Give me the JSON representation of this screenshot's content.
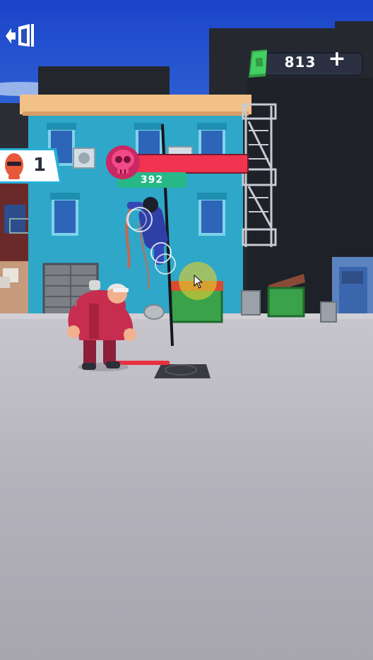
{
  "hud": {
    "cash_value": "813",
    "cash_plus": "+",
    "enemies_remaining": "1",
    "boss_hp_value": "392"
  },
  "colors": {
    "sky_top": "#1d4fd6",
    "sky_bottom": "#7fb0ef",
    "building_blue": "#2ea7c9",
    "ground": "#b7b5c0",
    "boss_bar": "#f0344f",
    "hp_green": "#27b887",
    "cash_green": "#3ec35b"
  },
  "icons": [
    "exit-door-icon",
    "cash-bill-icon",
    "plus-icon",
    "enemy-head-icon",
    "skull-icon",
    "cursor-icon"
  ]
}
